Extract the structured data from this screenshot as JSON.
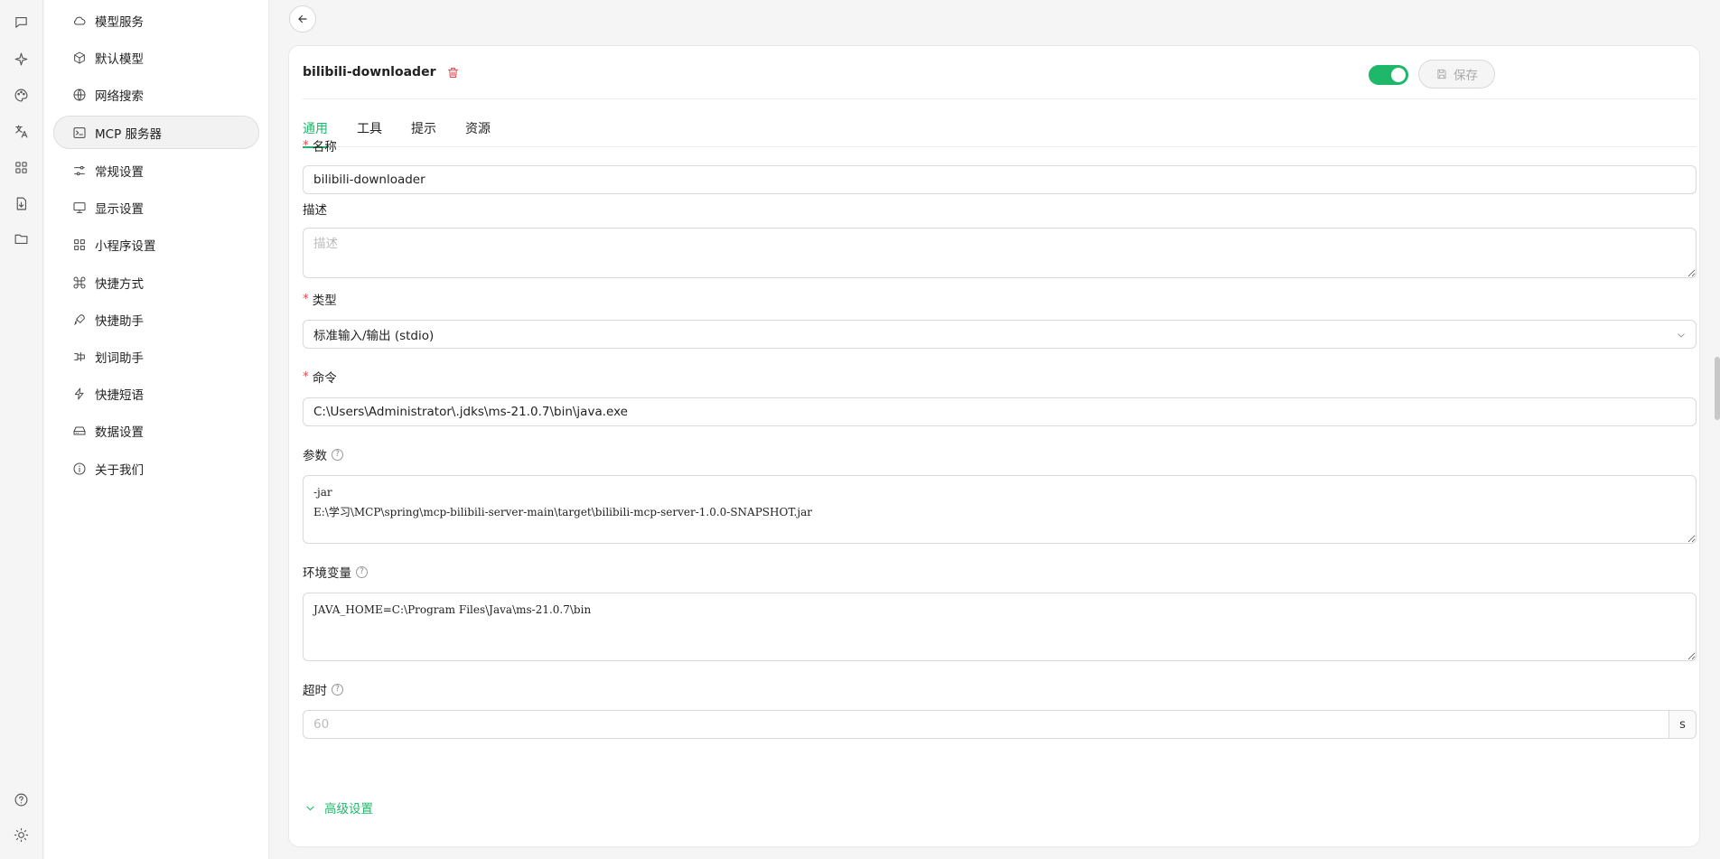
{
  "rail": {
    "icons": [
      "chat-icon",
      "sparkle-icon",
      "palette-icon",
      "translate-icon",
      "apps-icon",
      "file-icon",
      "folder-icon",
      "help-icon",
      "theme-icon"
    ]
  },
  "sidebar": {
    "items": [
      {
        "label": "模型服务",
        "icon": "cloud-icon"
      },
      {
        "label": "默认模型",
        "icon": "cube-icon"
      },
      {
        "label": "网络搜索",
        "icon": "globe-icon"
      },
      {
        "label": "MCP 服务器",
        "icon": "terminal-icon",
        "active": true
      },
      {
        "label": "常规设置",
        "icon": "sliders-icon"
      },
      {
        "label": "显示设置",
        "icon": "monitor-icon"
      },
      {
        "label": "小程序设置",
        "icon": "grid-icon"
      },
      {
        "label": "快捷方式",
        "icon": "command-icon"
      },
      {
        "label": "快捷助手",
        "icon": "rocket-icon"
      },
      {
        "label": "划词助手",
        "icon": "text-select-icon"
      },
      {
        "label": "快捷短语",
        "icon": "zap-icon"
      },
      {
        "label": "数据设置",
        "icon": "hard-drive-icon"
      },
      {
        "label": "关于我们",
        "icon": "info-icon"
      }
    ]
  },
  "server": {
    "name": "bilibili-downloader",
    "enabled": true,
    "save_label": "保存"
  },
  "tabs": [
    {
      "label": "通用",
      "active": true
    },
    {
      "label": "工具"
    },
    {
      "label": "提示"
    },
    {
      "label": "资源"
    }
  ],
  "form": {
    "name_label": "名称",
    "name_value": "bilibili-downloader",
    "desc_label": "描述",
    "desc_placeholder": "描述",
    "type_label": "类型",
    "type_value": "标准输入/输出 (stdio)",
    "command_label": "命令",
    "command_value": "C:\\Users\\Administrator\\.jdks\\ms-21.0.7\\bin\\java.exe",
    "args_label": "参数",
    "args_value": "-jar\nE:\\学习\\MCP\\spring\\mcp-bilibili-server-main\\target\\bilibili-mcp-server-1.0.0-SNAPSHOT.jar",
    "env_label": "环境变量",
    "env_value": "JAVA_HOME=C:\\Program Files\\Java\\ms-21.0.7\\bin",
    "timeout_label": "超时",
    "timeout_placeholder": "60",
    "timeout_unit": "s",
    "advanced_label": "高级设置",
    "required_mark": "*",
    "help_mark": "?"
  },
  "colors": {
    "accent": "#1fb86b",
    "danger": "#e5484d"
  }
}
